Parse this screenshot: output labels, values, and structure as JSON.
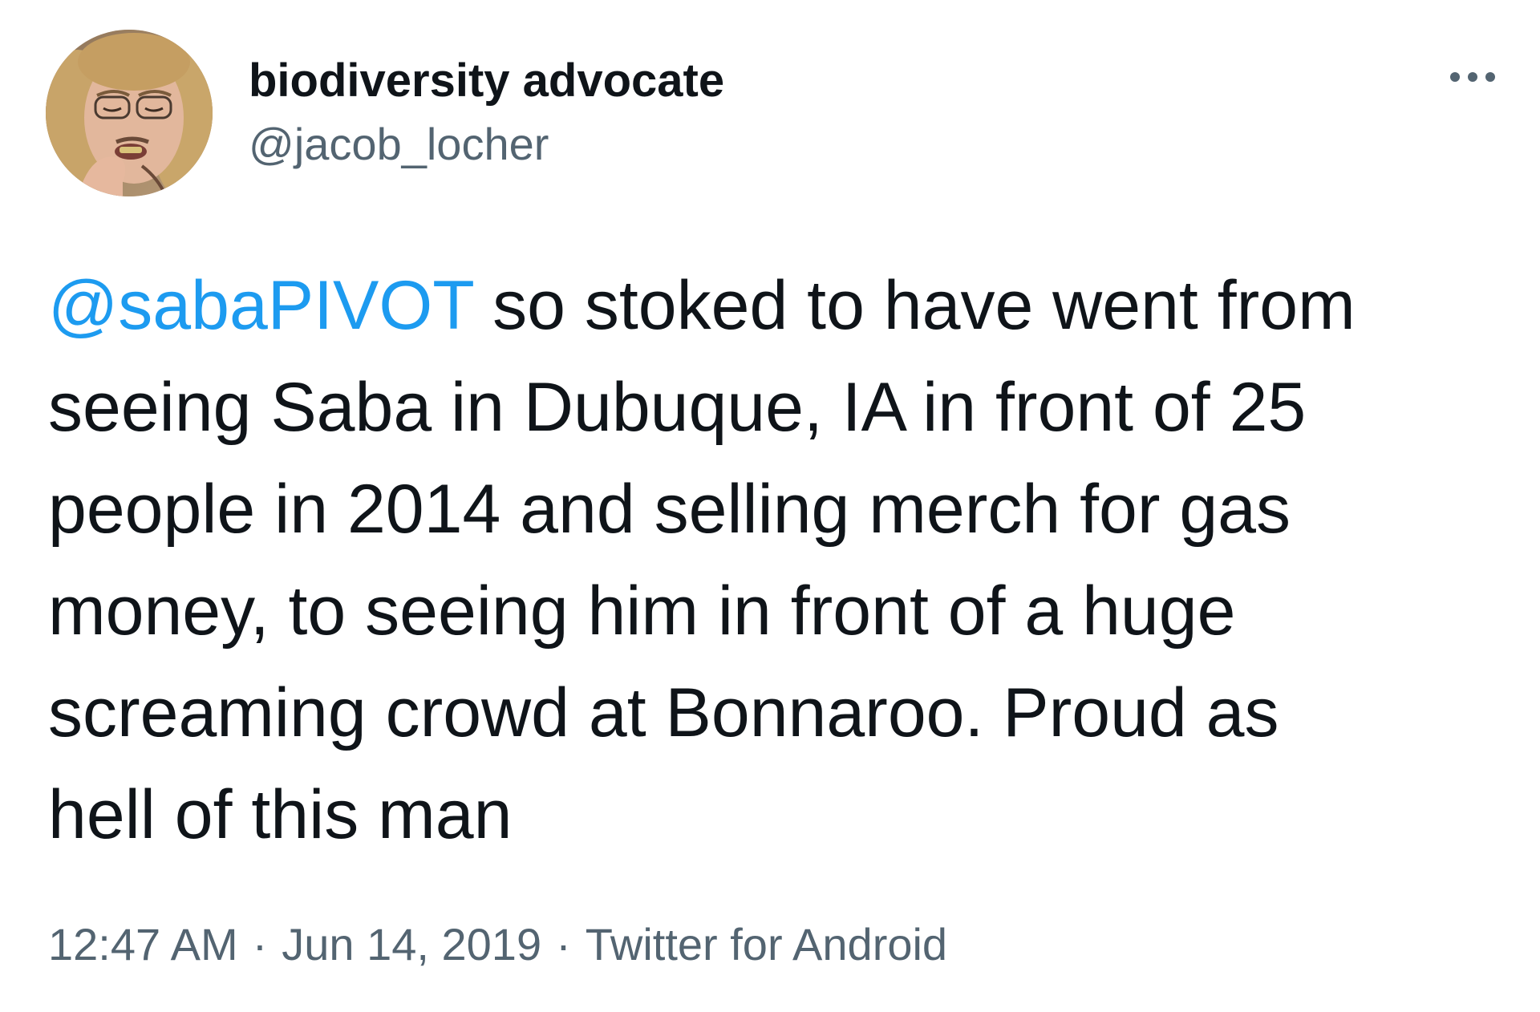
{
  "author": {
    "display_name": "biodiversity advocate",
    "handle": "@jacob_locher",
    "avatar_icon": "profile-photo"
  },
  "header": {
    "more_icon": "more-horizontal-icon"
  },
  "tweet": {
    "mention": "@sabaPIVOT",
    "lines": [
      " so stoked to have went from",
      "seeing Saba in Dubuque, IA in front of 25",
      "people in 2014 and selling merch for gas",
      "money, to seeing him in front of a huge",
      "screaming crowd at Bonnaroo. Proud as",
      "hell of this man"
    ]
  },
  "meta": {
    "time": "12:47 AM",
    "separator": "·",
    "date": "Jun 14, 2019",
    "source": "Twitter for Android"
  },
  "colors": {
    "text": "#0f1419",
    "secondary": "#536471",
    "link": "#1d9bf0"
  }
}
